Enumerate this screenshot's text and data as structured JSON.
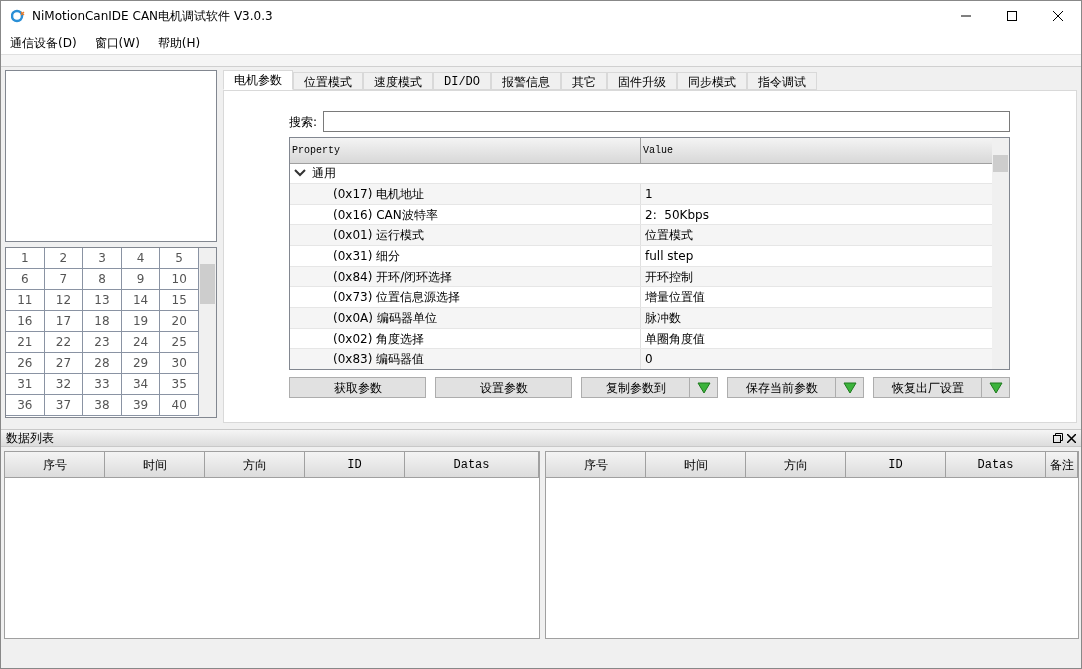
{
  "window": {
    "title": "NiMotionCanIDE CAN电机调试软件 V3.0.3"
  },
  "menu": [
    "通信设备(D)",
    "窗口(W)",
    "帮助(H)"
  ],
  "node_grid": {
    "cells": [
      "1",
      "2",
      "3",
      "4",
      "5",
      "6",
      "7",
      "8",
      "9",
      "10",
      "11",
      "12",
      "13",
      "14",
      "15",
      "16",
      "17",
      "18",
      "19",
      "20",
      "21",
      "22",
      "23",
      "24",
      "25",
      "26",
      "27",
      "28",
      "29",
      "30",
      "31",
      "32",
      "33",
      "34",
      "35",
      "36",
      "37",
      "38",
      "39",
      "40"
    ]
  },
  "tabs": [
    {
      "label": "电机参数",
      "selected": true
    },
    {
      "label": "位置模式",
      "selected": false
    },
    {
      "label": "速度模式",
      "selected": false
    },
    {
      "label": "DI/DO",
      "selected": false
    },
    {
      "label": "报警信息",
      "selected": false
    },
    {
      "label": "其它",
      "selected": false
    },
    {
      "label": "固件升级",
      "selected": false
    },
    {
      "label": "同步模式",
      "selected": false
    },
    {
      "label": "指令调试",
      "selected": false
    }
  ],
  "search": {
    "label": "搜索:"
  },
  "property_grid": {
    "columns": [
      "Property",
      "Value"
    ],
    "categories": [
      {
        "label": "通用",
        "expanded": true,
        "rows": [
          {
            "property": "(0x17) 电机地址",
            "value": "1"
          },
          {
            "property": "(0x16) CAN波特率",
            "value": "2:  50Kbps"
          },
          {
            "property": "(0x01) 运行模式",
            "value": "位置模式"
          },
          {
            "property": "(0x31) 细分",
            "value": "full step"
          },
          {
            "property": "(0x84) 开环/闭环选择",
            "value": "开环控制"
          },
          {
            "property": "(0x73) 位置信息源选择",
            "value": "增量位置值"
          },
          {
            "property": "(0x0A) 编码器单位",
            "value": "脉冲数"
          },
          {
            "property": "(0x02) 角度选择",
            "value": "单圈角度值"
          },
          {
            "property": "(0x83) 编码器值",
            "value": "0"
          }
        ]
      }
    ]
  },
  "buttons": [
    {
      "label": "获取参数",
      "kind": "plain"
    },
    {
      "label": "设置参数",
      "kind": "plain"
    },
    {
      "label": "复制参数到",
      "kind": "split"
    },
    {
      "label": "保存当前参数",
      "kind": "split"
    },
    {
      "label": "恢复出厂设置",
      "kind": "split"
    }
  ],
  "data_panel": {
    "title": "数据列表",
    "left_table": {
      "columns": [
        "序号",
        "时间",
        "方向",
        "ID",
        "Datas"
      ]
    },
    "right_table": {
      "columns": [
        "序号",
        "时间",
        "方向",
        "ID",
        "Datas",
        "备注"
      ]
    }
  }
}
